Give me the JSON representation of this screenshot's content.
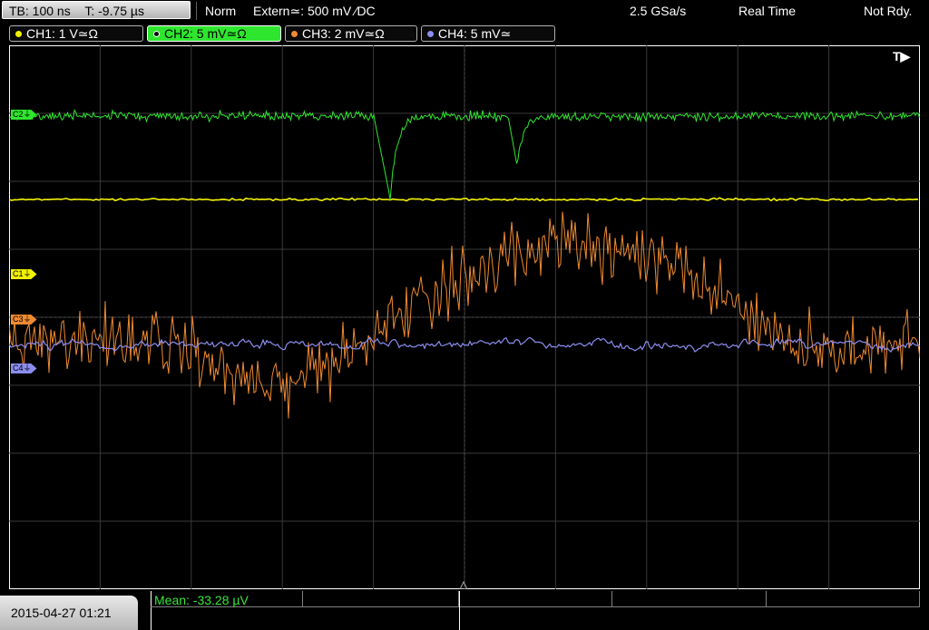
{
  "status": {
    "timebase": "TB: 100 ns",
    "trigger_time": "T: -9.75 µs",
    "mode": "Norm",
    "trigger_source": "Extern≃: 500 mV ⁄DC",
    "sample_rate": "2.5 GSa/s",
    "acquisition": "Real Time",
    "state": "Not Rdy."
  },
  "channels": [
    {
      "label": "CH1: 1 V≃Ω",
      "color": "#f2f200",
      "active": false
    },
    {
      "label": "CH2: 5 mV≃Ω",
      "color": "#2ee62e",
      "active": true
    },
    {
      "label": "CH3: 2 mV≃Ω",
      "color": "#f08a30",
      "active": false
    },
    {
      "label": "CH4: 5 mV≃",
      "color": "#8c8cf0",
      "active": false
    }
  ],
  "trace_markers": {
    "c1": "C1⏚",
    "c2": "C2⏚",
    "c3": "C3⏚",
    "c4": "C4⏚"
  },
  "trigger_indicator": "T▶",
  "measurement": {
    "label": "Mean: -33.28 µV"
  },
  "timestamp": "2015-04-27 01:21",
  "colors": {
    "ch1": "#f2f200",
    "ch2": "#2ee62e",
    "ch3": "#f08a30",
    "ch4": "#8c8cf0",
    "grid": "#3a3a3a"
  }
}
